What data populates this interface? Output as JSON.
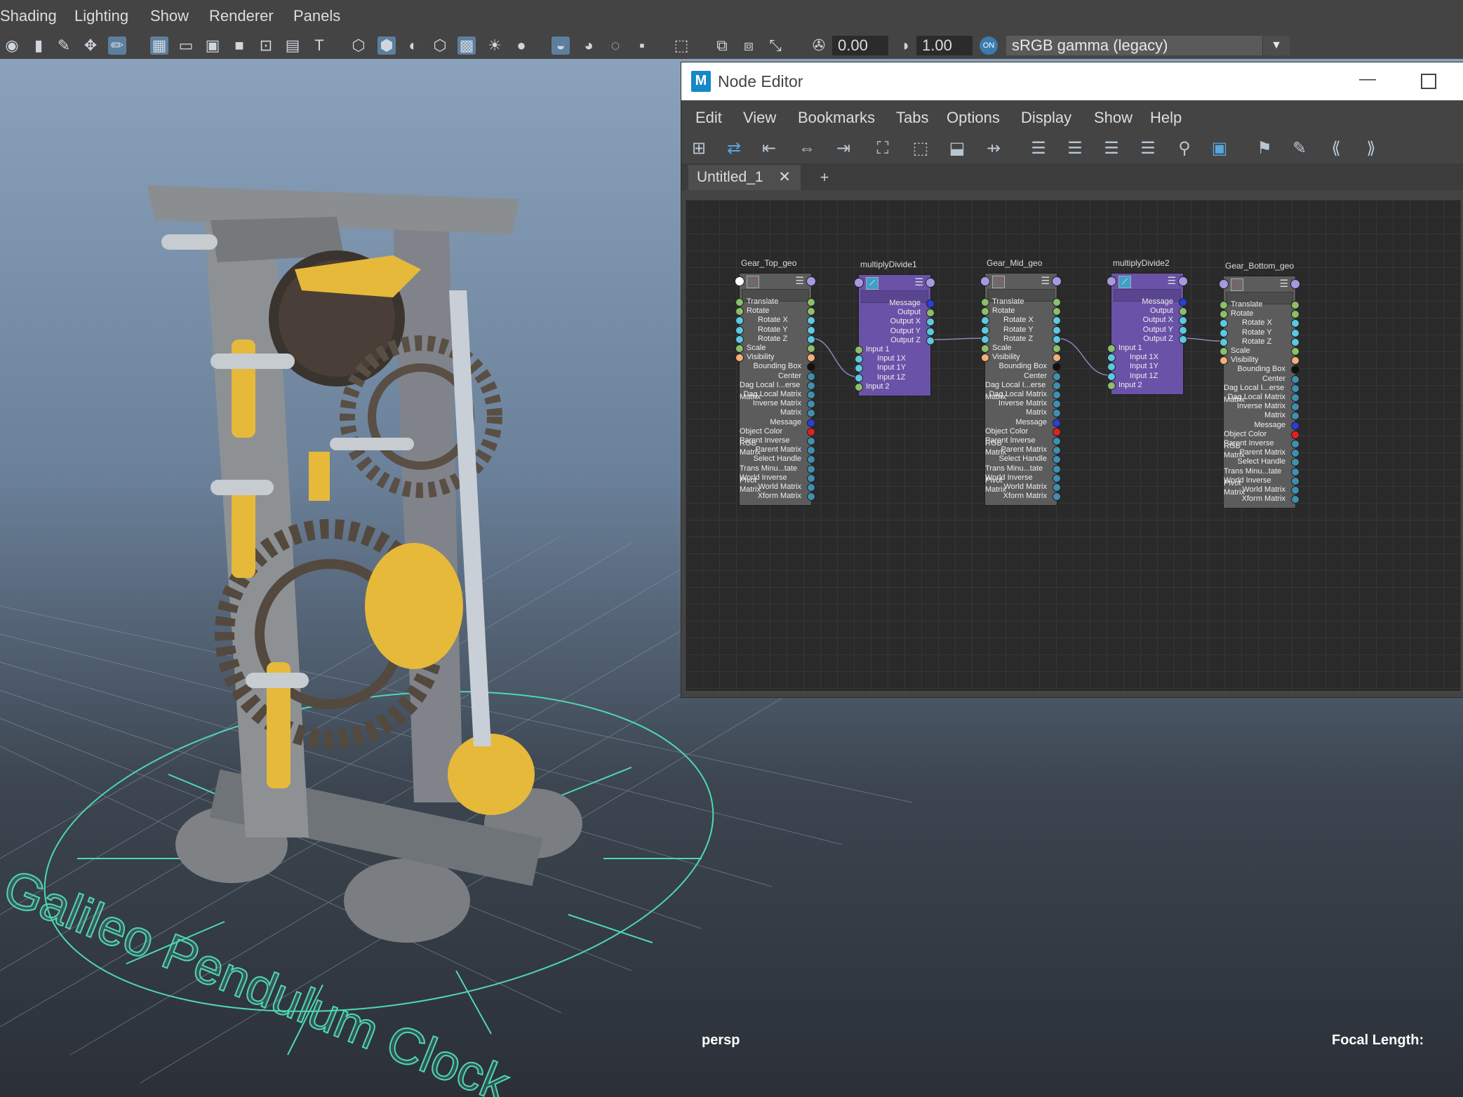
{
  "menu": {
    "items": [
      "Shading",
      "Lighting",
      "Show",
      "Renderer",
      "Panels"
    ]
  },
  "toolbar": {
    "exposure": "0.00",
    "gamma": "1.00",
    "cm_toggle": "ON",
    "view_transform": "sRGB gamma (legacy)"
  },
  "viewport": {
    "camera_label": "persp",
    "focal_label": "Focal Length:",
    "scene_text": "Galileo Pendulum Clock"
  },
  "node_editor": {
    "logo": "M",
    "title": "Node Editor",
    "menu": [
      "Edit",
      "View",
      "Bookmarks",
      "Tabs",
      "Options",
      "Display",
      "Show",
      "Help"
    ],
    "tab": "Untitled_1",
    "tab_close": "✕",
    "tab_add": "+",
    "nodes": [
      {
        "name": "Gear_Top_geo",
        "type": "transform",
        "attrs": [
          "Translate",
          "Rotate",
          "Rotate X",
          "Rotate Y",
          "Rotate Z",
          "Scale",
          "Visibility",
          "Bounding Box",
          "Center",
          "Dag Local I...erse Matrix",
          "Dag Local Matrix",
          "Inverse Matrix",
          "Matrix",
          "Message",
          "Object Color RGB",
          "Parent Inverse Matrix",
          "Parent Matrix",
          "Select Handle",
          "Trans Minu...tate Pivot",
          "World Inverse Matrix",
          "World Matrix",
          "Xform Matrix"
        ]
      },
      {
        "name": "multiplyDivide1",
        "type": "multiplyDivide",
        "attrs": [
          "Message",
          "Output",
          "Output X",
          "Output Y",
          "Output Z",
          "Input 1",
          "Input 1X",
          "Input 1Y",
          "Input 1Z",
          "Input 2"
        ]
      },
      {
        "name": "Gear_Mid_geo",
        "type": "transform",
        "attrs": [
          "Translate",
          "Rotate",
          "Rotate X",
          "Rotate Y",
          "Rotate Z",
          "Scale",
          "Visibility",
          "Bounding Box",
          "Center",
          "Dag Local I...erse Matrix",
          "Dag Local Matrix",
          "Inverse Matrix",
          "Matrix",
          "Message",
          "Object Color RGB",
          "Parent Inverse Matrix",
          "Parent Matrix",
          "Select Handle",
          "Trans Minu...tate Pivot",
          "World Inverse Matrix",
          "World Matrix",
          "Xform Matrix"
        ]
      },
      {
        "name": "multiplyDivide2",
        "type": "multiplyDivide",
        "attrs": [
          "Message",
          "Output",
          "Output X",
          "Output Y",
          "Output Z",
          "Input 1",
          "Input 1X",
          "Input 1Y",
          "Input 1Z",
          "Input 2"
        ]
      },
      {
        "name": "Gear_Bottom_geo",
        "type": "transform",
        "attrs": [
          "Translate",
          "Rotate",
          "Rotate X",
          "Rotate Y",
          "Rotate Z",
          "Scale",
          "Visibility",
          "Bounding Box",
          "Center",
          "Dag Local I...erse Matrix",
          "Dag Local Matrix",
          "Inverse Matrix",
          "Matrix",
          "Message",
          "Object Color RGB",
          "Parent Inverse Matrix",
          "Parent Matrix",
          "Select Handle",
          "Trans Minu...tate Pivot",
          "World Inverse Matrix",
          "World Matrix",
          "Xform Matrix"
        ]
      }
    ]
  },
  "colors": {
    "accent": "#5d7f9e",
    "node_transform": "#5c5c5c",
    "node_utility": "#6a52a8",
    "curve_green": "#4fd7b0",
    "gold": "#e6b93a",
    "steel": "#8a8d90"
  }
}
